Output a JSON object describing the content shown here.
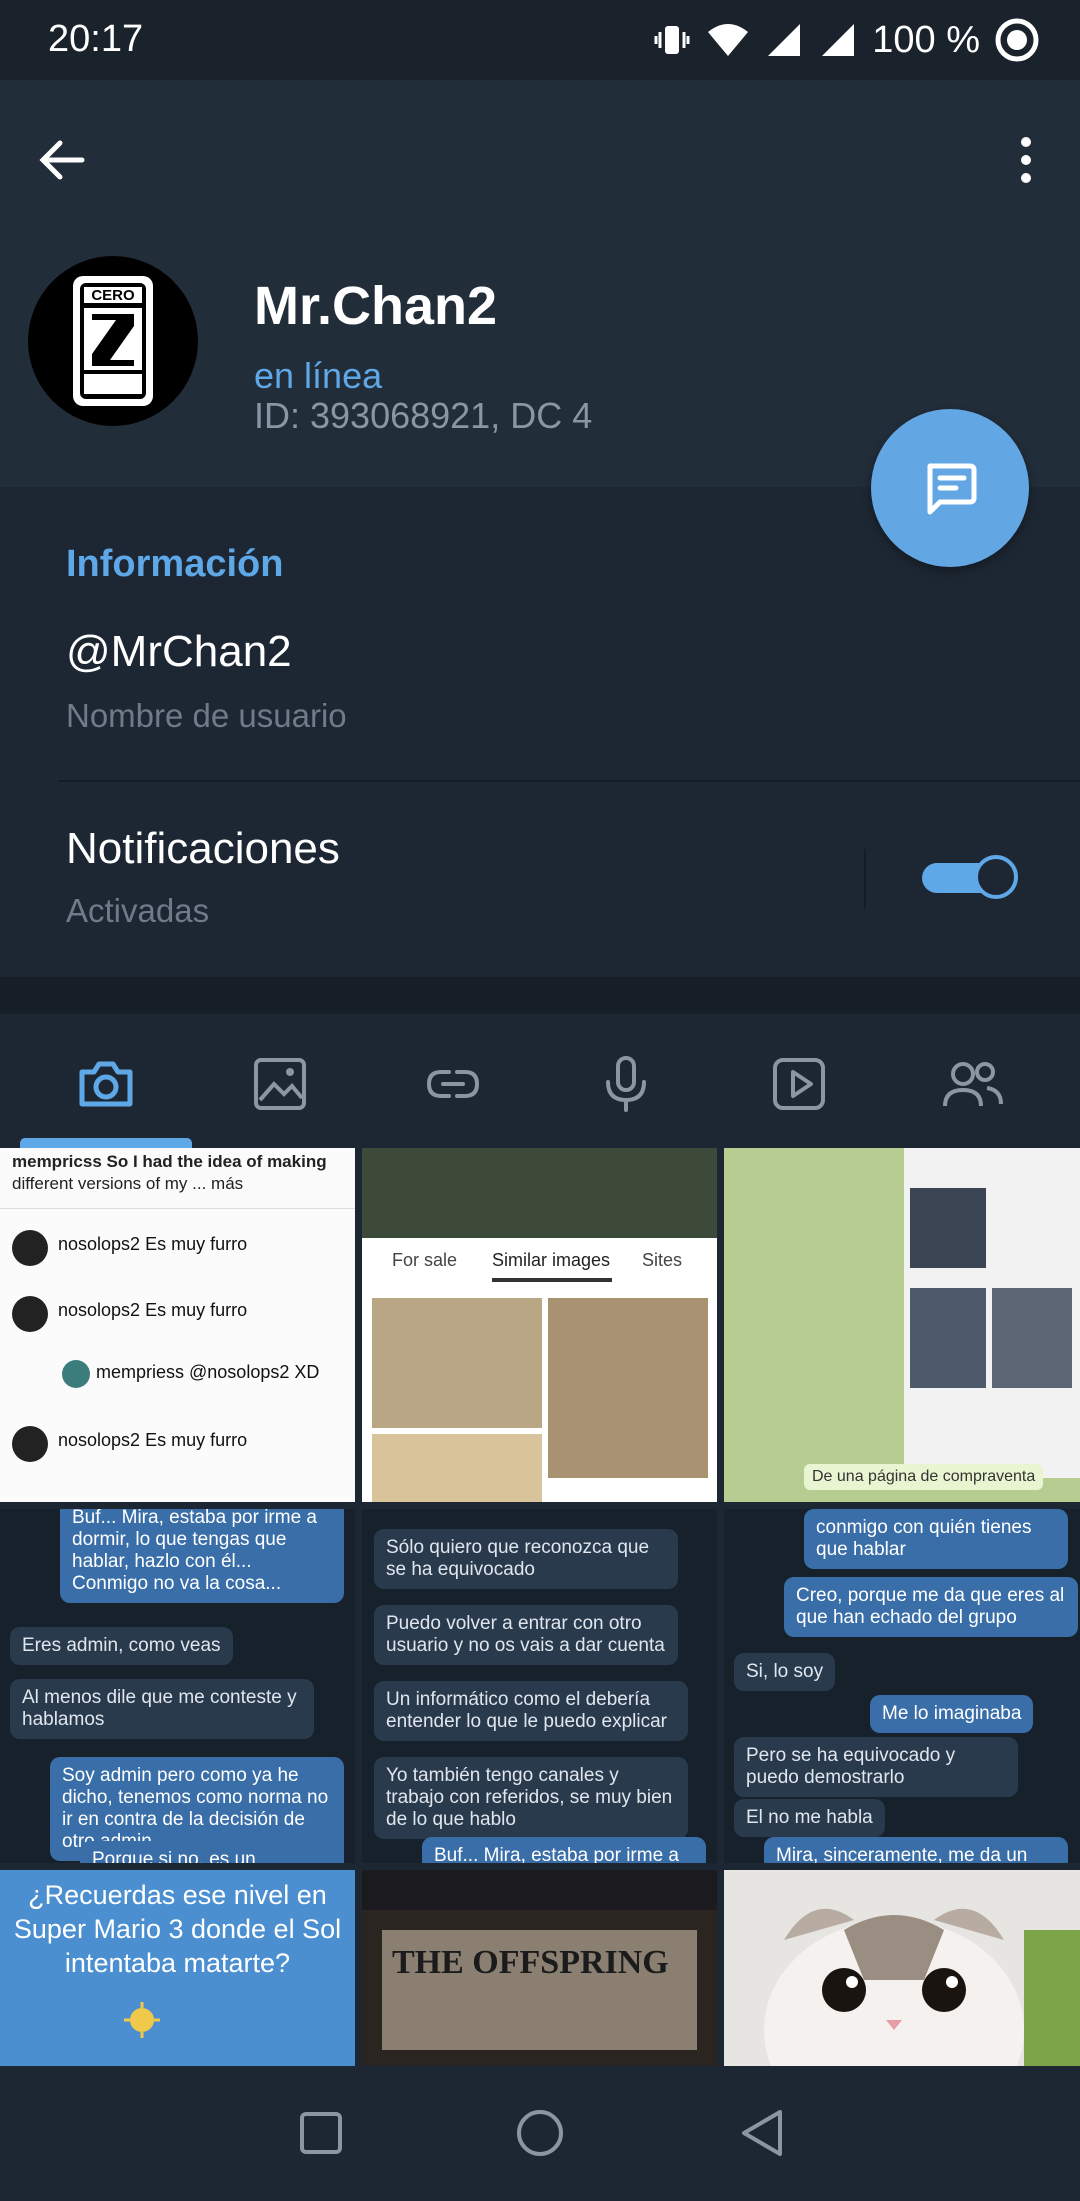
{
  "status_bar": {
    "time": "20:17",
    "battery": "100 %"
  },
  "profile": {
    "name": "Mr.Chan2",
    "status": "en línea",
    "id_line": "ID: 393068921, DC 4",
    "avatar_text": "CERO"
  },
  "info": {
    "section_title": "Información",
    "username": "@MrChan2",
    "username_label": "Nombre de usuario",
    "notifications_title": "Notificaciones",
    "notifications_value": "Activadas",
    "notifications_on": true
  },
  "media_tabs": [
    {
      "icon": "camera-icon"
    },
    {
      "icon": "image-icon"
    },
    {
      "icon": "link-icon"
    },
    {
      "icon": "microphone-icon"
    },
    {
      "icon": "video-icon"
    },
    {
      "icon": "group-icon"
    }
  ],
  "grid": {
    "c1": {
      "l1": "mempricss So I had the idea of making",
      "l2": "different versions of my ... más",
      "r1": "nosolops2 Es muy furro",
      "r2": "nosolops2 Es muy furro",
      "r3": "mempriess @nosolops2 XD",
      "r4": "nosolops2 Es muy furro"
    },
    "c2": {
      "tab1": "For sale",
      "tab2": "Similar images",
      "tab3": "Sites"
    },
    "c3": {
      "caption": "De una página de compraventa"
    },
    "c4": {
      "m1": "Buf... Mira, estaba por irme a dormir, lo que tengas que hablar, hazlo con él... Conmigo no va la cosa...",
      "m2": "Eres admin, como veas",
      "m3": "Al menos dile que me conteste y hablamos",
      "m4": "Soy admin pero como ya he dicho, tenemos como norma no ir en contra de la decisión de otro admin",
      "m5": "Porque si no, es un despiporre"
    },
    "c5": {
      "m1": "Sólo quiero que reconozca que se ha equivocado",
      "m2": "Puedo volver a entrar con otro usuario y no os vais a dar cuenta",
      "m3": "Un informático como el debería entender lo que le puedo explicar",
      "m4": "Yo también tengo canales y trabajo con referidos, se muy bien de lo que hablo",
      "m5": "Buf... Mira, estaba por irme a"
    },
    "c6": {
      "m1": "conmigo con quién tienes que hablar",
      "m2": "Creo, porque me da que eres al que han echado del grupo",
      "m3": "Si, lo soy",
      "m4": "Me lo imaginaba",
      "m5": "Pero se ha equivocado y puedo demostrarlo",
      "m6": "El no me habla",
      "m7": "Mira, sinceramente, me da un"
    },
    "c7": {
      "text": "¿Recuerdas ese nivel en Super Mario 3 donde el Sol intentaba matarte?"
    },
    "c8": {
      "text": "THE OFFSPRING"
    }
  },
  "colors": {
    "accent": "#5fa8e8",
    "background": "#1d2733",
    "header": "#222d3a"
  }
}
